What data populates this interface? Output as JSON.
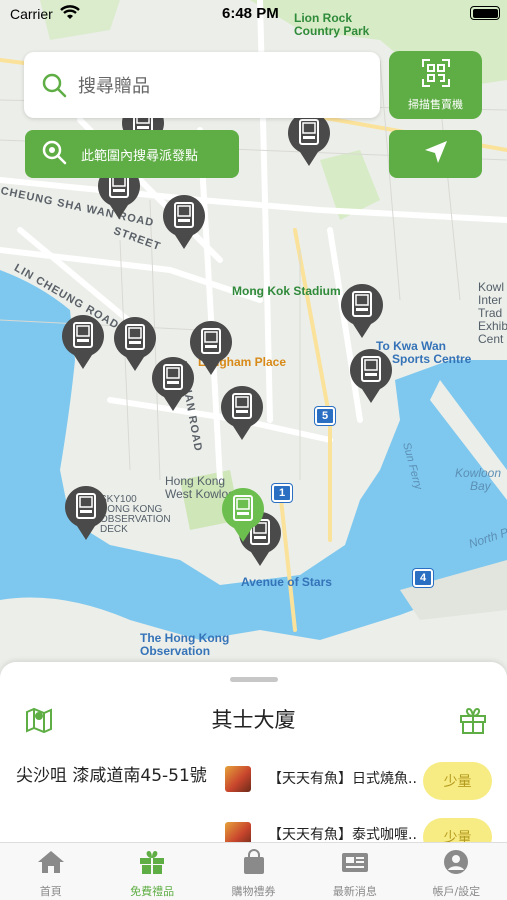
{
  "status_bar": {
    "carrier": "Carrier",
    "time": "6:48 PM"
  },
  "map": {
    "labels": {
      "lion_rock": "Lion Rock",
      "country_park": "Country Park",
      "mong_kok_stadium": "Mong Kok Stadium",
      "langham_place": "Langham Place",
      "to_kwa_wan_1": "To Kwa Wan",
      "to_kwa_wan_2": "Sports Centre",
      "hong_kong_west_1": "Hong Kong",
      "hong_kong_west_2": "West Kowloon",
      "sky100_1": "SKY100",
      "sky100_2": "HONG KONG",
      "sky100_3": "OBSERVATION",
      "sky100_4": "DECK",
      "avenue_of_stars": "Avenue of Stars",
      "observation_1": "The Hong Kong",
      "observation_2": "Observation",
      "kowloon_bay_1": "Kowloon",
      "kowloon_bay_2": "Bay",
      "north_point": "North Po",
      "sun_ferry": "Sun Ferry",
      "kowl_1": "Kowl",
      "kowl_2": "Inter",
      "kowl_3": "Trad",
      "kowl_4": "Exhib",
      "kowl_5": "Cent",
      "cheung_sha_wan_road": "CHEUNG SHA WAN ROAD",
      "lin_cheung_road": "LIN CHEUNG ROAD",
      "street": "STREET",
      "nathan_road": "NATHAN ROAD"
    },
    "routes": {
      "r5": "5",
      "r1": "1",
      "r4": "4"
    }
  },
  "search": {
    "placeholder": "搜尋贈品"
  },
  "scan_button": {
    "label": "掃描售賣機"
  },
  "area_search_button": {
    "label": "此範圍內搜尋派發點"
  },
  "sheet": {
    "title": "其士大廈",
    "address": "尖沙咀 漆咸道南45-51號",
    "items": [
      {
        "name": "【天天有魚】日式燒魚...",
        "badge": "少量"
      },
      {
        "name": "【天天有魚】泰式咖喱...",
        "badge": "少量"
      }
    ]
  },
  "tabs": [
    {
      "label": "首頁",
      "icon": "home-icon"
    },
    {
      "label": "免費禮品",
      "icon": "gift-icon"
    },
    {
      "label": "購物禮券",
      "icon": "shopping-bag-icon"
    },
    {
      "label": "最新消息",
      "icon": "newspaper-icon"
    },
    {
      "label": "帳戶/設定",
      "icon": "account-icon"
    }
  ],
  "colors": {
    "brand_green": "#5fae45",
    "badge_yellow": "#f7ec83",
    "pin_dark": "#4a4a4a",
    "water": "#7ec8ef"
  }
}
